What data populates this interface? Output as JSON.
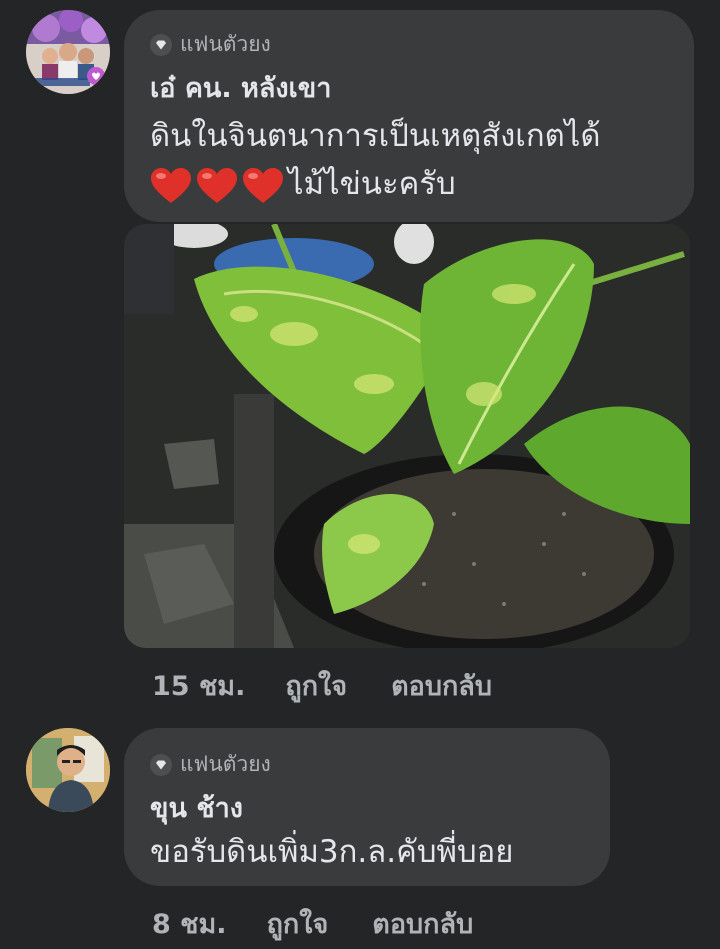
{
  "comment1": {
    "badge": "แฟนตัวยง",
    "author": "เอ๋ คน. หลังเขา",
    "line1": "ดินในจินตนาการเป็นเหตุสังเกตได้",
    "line2_suffix": "ไม้ไข่นะครับ",
    "time": "15 ชม.",
    "like": "ถูกใจ",
    "reply": "ตอบกลับ",
    "heart_color": "#e0302a"
  },
  "comment2": {
    "badge": "แฟนตัวยง",
    "author": "ขุน ช้าง",
    "line1": "ขอรับดินเพิ่ม3ก.ล.คับพี่บอย",
    "time": "8 ชม.",
    "like": "ถูกใจ",
    "reply": "ตอบกลับ"
  },
  "icons": {
    "badge": "diamond-icon",
    "heart": "heart-emoji",
    "photo": "plant-photo"
  },
  "colors": {
    "background": "#242526",
    "bubble": "#3a3b3c",
    "text": "#e4e6eb",
    "secondary": "#b0b3b8"
  }
}
